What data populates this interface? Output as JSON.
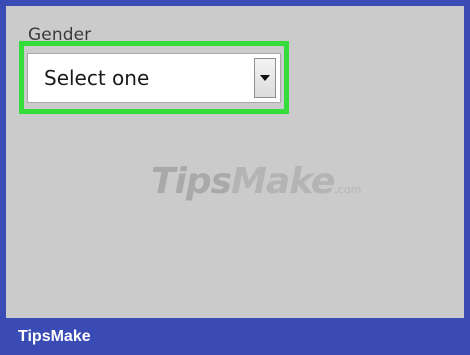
{
  "form": {
    "gender_label": "Gender",
    "gender_select_value": "Select one",
    "highlight_color": "#35dc3a"
  },
  "watermark": {
    "brand_tips": "Tips",
    "brand_make": "Make",
    "brand_suffix": ".com"
  },
  "footer": {
    "brand": "TipsMake"
  },
  "colors": {
    "frame": "#3a4bb5",
    "panel": "#cbcbcb"
  },
  "icons": {
    "dropdown": "chevron-down-icon"
  }
}
